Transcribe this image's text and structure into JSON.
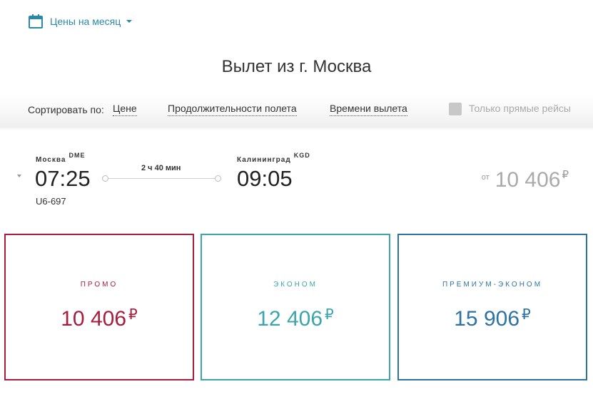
{
  "header": {
    "month_label": "Цены на месяц",
    "calendar_icon": "calendar-icon",
    "title": "Вылет из г. Москва"
  },
  "sort": {
    "label": "Сортировать по:",
    "options": [
      "Цене",
      "Продолжительности полета",
      "Времени вылета"
    ],
    "direct_only_label": "Только прямые рейсы",
    "direct_only_checked": false
  },
  "flight": {
    "departure_city": "Москва",
    "departure_code": "DME",
    "departure_time": "07:25",
    "arrival_city": "Калининград",
    "arrival_code": "KGD",
    "arrival_time": "09:05",
    "duration": "2 ч 40 мин",
    "flight_number": "U6-697",
    "from_prefix": "от",
    "from_price": "10 406",
    "currency": "₽"
  },
  "fares": [
    {
      "name": "ПРОМО",
      "price": "10 406",
      "currency": "₽",
      "color": "#a81c3e"
    },
    {
      "name": "ЭКОНОМ",
      "price": "12 406",
      "currency": "₽",
      "color": "#3ba5ad"
    },
    {
      "name": "ПРЕМИУМ-ЭКОНОМ",
      "price": "15 906",
      "currency": "₽",
      "color": "#2c73a3"
    }
  ]
}
